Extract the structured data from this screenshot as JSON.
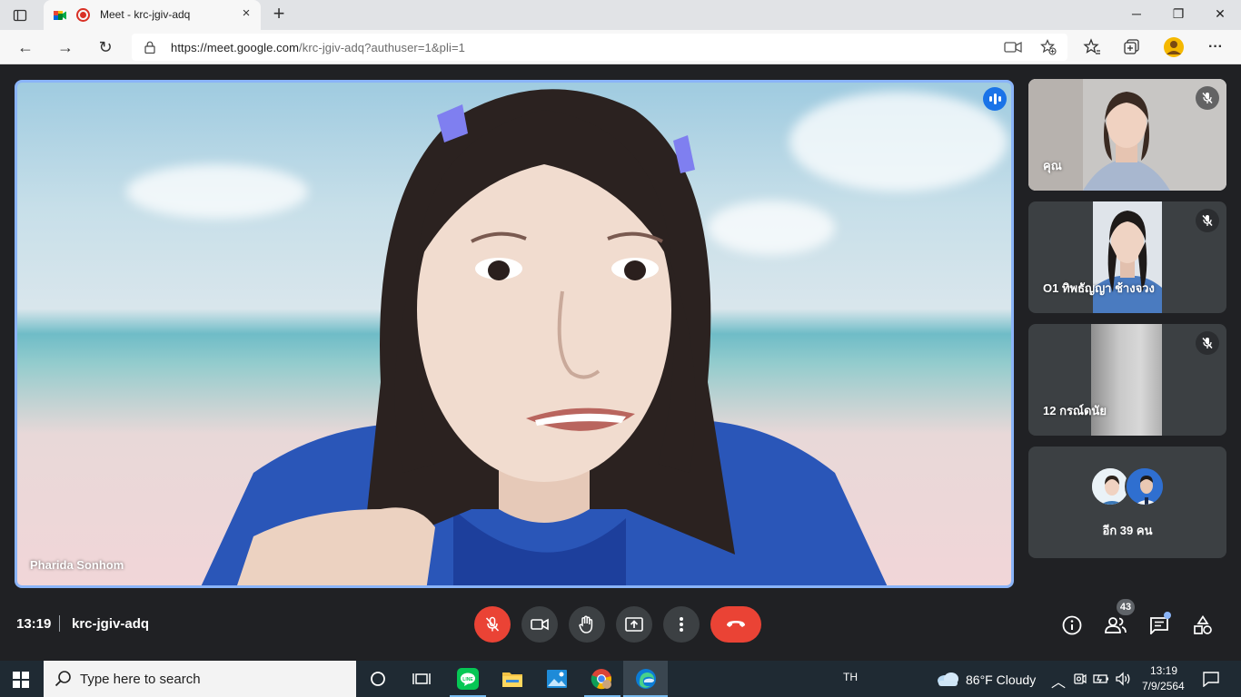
{
  "browser": {
    "tab_title": "Meet - krc-jgiv-adq",
    "tab_close": "×",
    "new_tab": "+",
    "window": {
      "minimize": "─",
      "restore": "❐",
      "close": "✕"
    },
    "url_host": "https://meet.google.com",
    "url_path": "/krc-jgiv-adq?authuser=1&pli=1",
    "nav": {
      "back": "←",
      "forward": "→",
      "reload": "↻"
    }
  },
  "meet": {
    "main_speaker": "Pharida Sonhom",
    "participants": [
      {
        "name": "คุณ",
        "muted": true
      },
      {
        "name": "O1 ทิพธัญญา ช้างจวง",
        "muted": true
      },
      {
        "name": "12 กรณ์ดนัย",
        "muted": true
      }
    ],
    "more_participants": "อีก 39 คน",
    "time": "13:19",
    "meeting_code": "krc-jgiv-adq",
    "people_count": "43",
    "colors": {
      "accent": "#8ab4f8",
      "danger": "#ea4335",
      "surface": "#3c4043",
      "background": "#202124"
    }
  },
  "taskbar": {
    "search_placeholder": "Type here to search",
    "language": "TH",
    "weather": "86°F  Cloudy",
    "clock_time": "13:19",
    "clock_date": "7/9/2564"
  }
}
